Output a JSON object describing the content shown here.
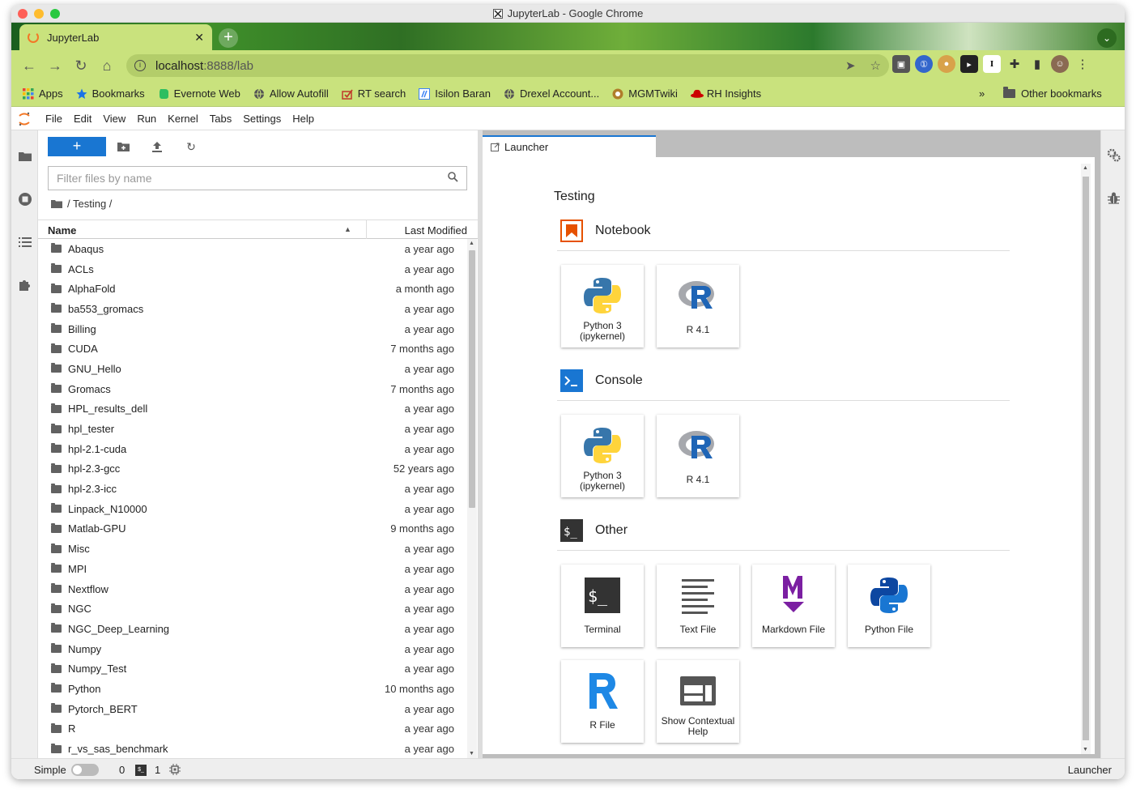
{
  "window": {
    "title": "JupyterLab - Google Chrome"
  },
  "browser": {
    "tab_title": "JupyterLab",
    "url_host": "localhost",
    "url_rest": ":8888/lab",
    "bookmarks": [
      {
        "label": "Apps",
        "icon": "apps-grid-icon",
        "color": "#e8453c"
      },
      {
        "label": "Bookmarks",
        "icon": "star-icon",
        "color": "#1a73e8"
      },
      {
        "label": "Evernote Web",
        "icon": "evernote-icon",
        "color": "#2dbe60"
      },
      {
        "label": "Allow Autofill",
        "icon": "globe-icon",
        "color": "#555555"
      },
      {
        "label": "RT search",
        "icon": "rt-icon",
        "color": "#c0392b"
      },
      {
        "label": "Isilon Baran",
        "icon": "isilon-icon",
        "color": "#3b82f6"
      },
      {
        "label": "Drexel Account...",
        "icon": "globe-icon",
        "color": "#555555"
      },
      {
        "label": "MGMTwiki",
        "icon": "wiki-icon",
        "color": "#b07d2a"
      },
      {
        "label": "RH Insights",
        "icon": "redhat-icon",
        "color": "#cc0000"
      }
    ],
    "more_label": "»",
    "other_bookmarks": "Other bookmarks"
  },
  "menubar": [
    "File",
    "Edit",
    "View",
    "Run",
    "Kernel",
    "Tabs",
    "Settings",
    "Help"
  ],
  "filebrowser": {
    "new_label": "+",
    "filter_placeholder": "Filter files by name",
    "breadcrumb": "/ Testing /",
    "col_name": "Name",
    "col_modified": "Last Modified",
    "files": [
      {
        "name": "Abaqus",
        "modified": "a year ago"
      },
      {
        "name": "ACLs",
        "modified": "a year ago"
      },
      {
        "name": "AlphaFold",
        "modified": "a month ago"
      },
      {
        "name": "ba553_gromacs",
        "modified": "a year ago"
      },
      {
        "name": "Billing",
        "modified": "a year ago"
      },
      {
        "name": "CUDA",
        "modified": "7 months ago"
      },
      {
        "name": "GNU_Hello",
        "modified": "a year ago"
      },
      {
        "name": "Gromacs",
        "modified": "7 months ago"
      },
      {
        "name": "HPL_results_dell",
        "modified": "a year ago"
      },
      {
        "name": "hpl_tester",
        "modified": "a year ago"
      },
      {
        "name": "hpl-2.1-cuda",
        "modified": "a year ago"
      },
      {
        "name": "hpl-2.3-gcc",
        "modified": "52 years ago"
      },
      {
        "name": "hpl-2.3-icc",
        "modified": "a year ago"
      },
      {
        "name": "Linpack_N10000",
        "modified": "a year ago"
      },
      {
        "name": "Matlab-GPU",
        "modified": "9 months ago"
      },
      {
        "name": "Misc",
        "modified": "a year ago"
      },
      {
        "name": "MPI",
        "modified": "a year ago"
      },
      {
        "name": "Nextflow",
        "modified": "a year ago"
      },
      {
        "name": "NGC",
        "modified": "a year ago"
      },
      {
        "name": "NGC_Deep_Learning",
        "modified": "a year ago"
      },
      {
        "name": "Numpy",
        "modified": "a year ago"
      },
      {
        "name": "Numpy_Test",
        "modified": "a year ago"
      },
      {
        "name": "Python",
        "modified": "10 months ago"
      },
      {
        "name": "Pytorch_BERT",
        "modified": "a year ago"
      },
      {
        "name": "R",
        "modified": "a year ago"
      },
      {
        "name": "r_vs_sas_benchmark",
        "modified": "a year ago"
      }
    ]
  },
  "launcher": {
    "tab_label": "Launcher",
    "heading": "Testing",
    "sections": [
      {
        "title": "Notebook",
        "icon": "notebook-icon",
        "color": "#e65100",
        "cards": [
          {
            "label": "Python 3\n(ipykernel)",
            "icon": "python-logo-icon"
          },
          {
            "label": "R 4.1",
            "icon": "r-logo-icon"
          }
        ]
      },
      {
        "title": "Console",
        "icon": "console-icon",
        "color": "#1976d2",
        "cards": [
          {
            "label": "Python 3\n(ipykernel)",
            "icon": "python-logo-icon"
          },
          {
            "label": "R 4.1",
            "icon": "r-logo-icon"
          }
        ]
      },
      {
        "title": "Other",
        "icon": "terminal-icon",
        "color": "#333333",
        "cards": [
          {
            "label": "Terminal",
            "icon": "terminal-icon"
          },
          {
            "label": "Text File",
            "icon": "text-file-icon"
          },
          {
            "label": "Markdown File",
            "icon": "markdown-icon"
          },
          {
            "label": "Python File",
            "icon": "python-file-icon"
          },
          {
            "label": "R File",
            "icon": "r-file-icon"
          },
          {
            "label": "Show Contextual\nHelp",
            "icon": "contextual-help-icon"
          }
        ]
      }
    ]
  },
  "statusbar": {
    "simple_label": "Simple",
    "kernels": "0",
    "terminals": "1",
    "mode": "Launcher"
  }
}
